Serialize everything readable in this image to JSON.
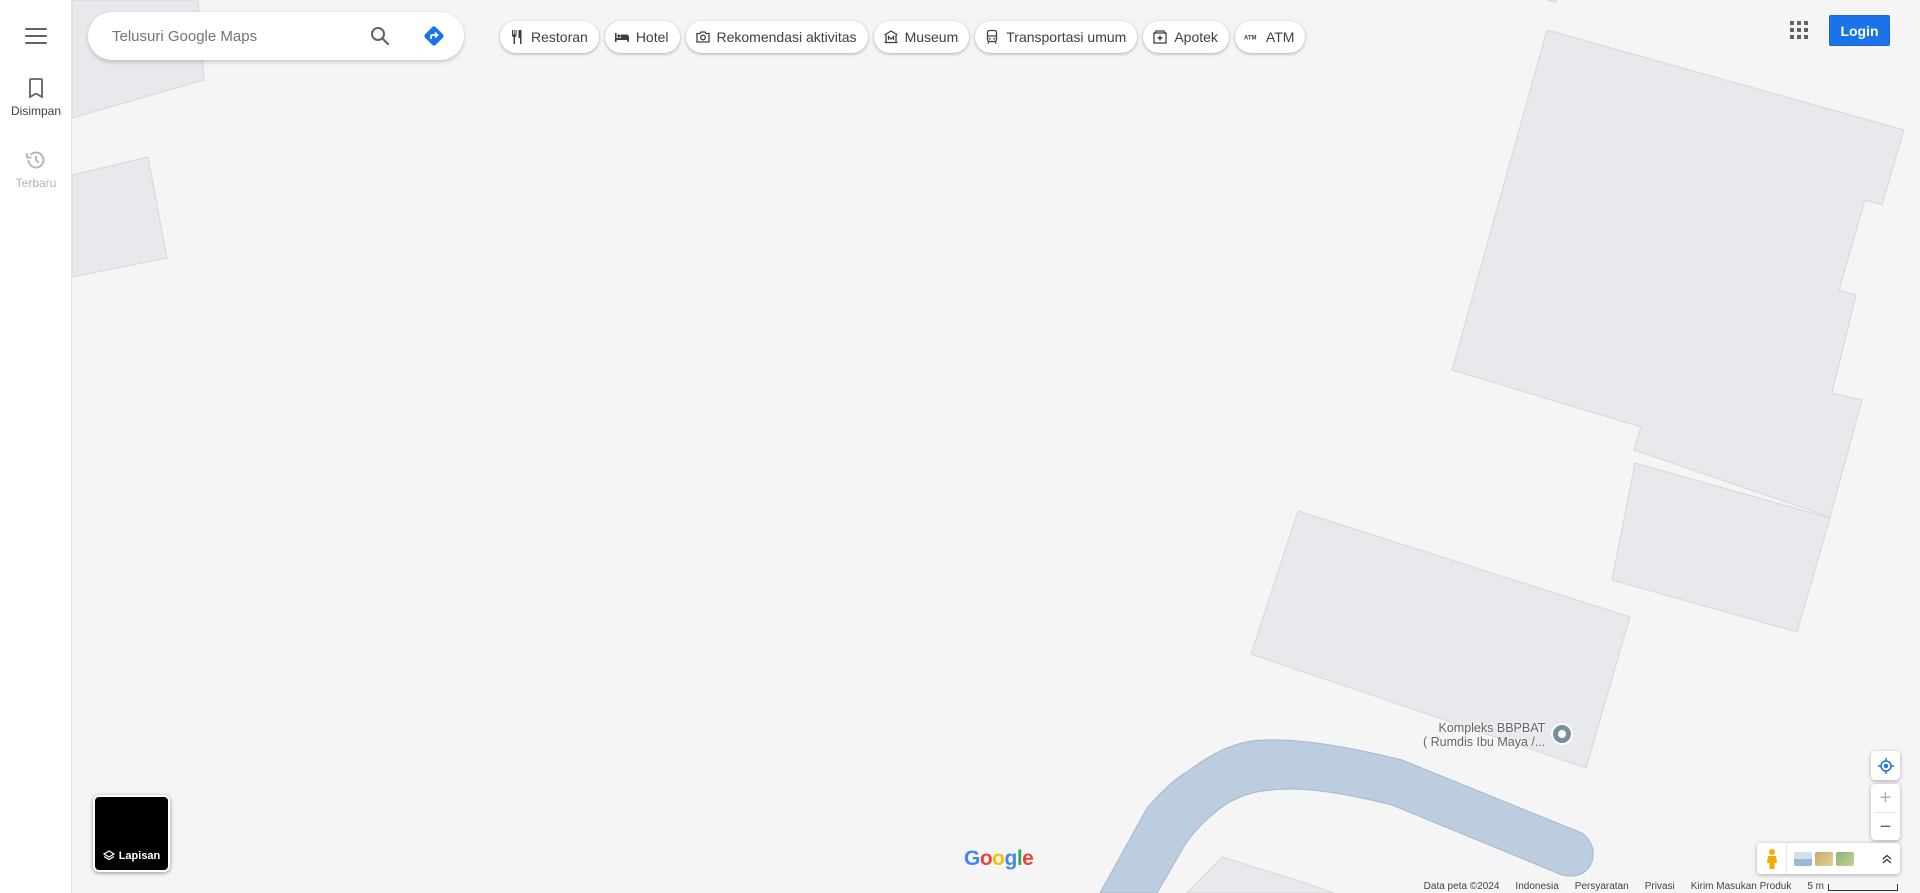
{
  "search": {
    "placeholder": "Telusuri Google Maps"
  },
  "icons": {
    "search": "search-icon",
    "directions": "directions-icon",
    "menu": "menu-icon",
    "apps": "apps-grid-icon",
    "layers": "layers-icon",
    "my_location": "my-location-icon",
    "pegman": "pegman-icon",
    "expand": "chevron-up-double-icon"
  },
  "rail": {
    "saved_label": "Disimpan",
    "recent_label": "Terbaru"
  },
  "chips": [
    {
      "label": "Restoran",
      "icon": "restaurant-icon"
    },
    {
      "label": "Hotel",
      "icon": "hotel-icon"
    },
    {
      "label": "Rekomendasi aktivitas",
      "icon": "camera-icon"
    },
    {
      "label": "Museum",
      "icon": "museum-icon"
    },
    {
      "label": "Transportasi umum",
      "icon": "transit-icon"
    },
    {
      "label": "Apotek",
      "icon": "pharmacy-icon"
    },
    {
      "label": "ATM",
      "icon": "atm-icon"
    }
  ],
  "header": {
    "login_label": "Login"
  },
  "layers": {
    "label": "Lapisan"
  },
  "map": {
    "place_name_line1": "Kompleks BBPBAT",
    "place_name_line2": "( Rumdis Ibu Maya /...",
    "logo_text": "Google"
  },
  "zoom": {
    "in_label": "+",
    "out_label": "−"
  },
  "footer": {
    "map_data": "Data peta ©2024",
    "country": "Indonesia",
    "terms": "Persyaratan",
    "privacy": "Privasi",
    "feedback": "Kirim Masukan Produk",
    "scale": "5 m"
  },
  "colors": {
    "accent": "#1a73e8",
    "map_background": "#f5f5f5",
    "building_fill": "#e8e9ec",
    "building_stroke": "#d5d7dc",
    "water": "#bccde0",
    "water_stroke": "#a7b8cc"
  }
}
